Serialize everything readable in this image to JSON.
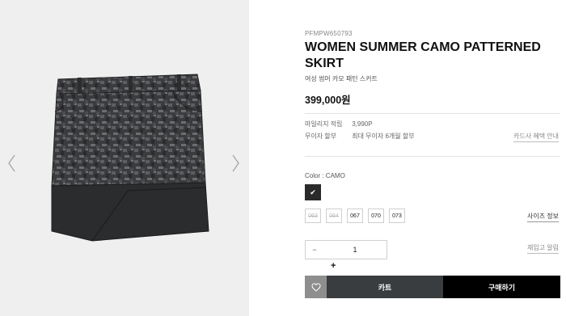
{
  "product": {
    "sku": "PFMPW650793",
    "title": "WOMEN SUMMER CAMO PATTERNED SKIRT",
    "subtitle_kr": "여성 썸머 카모 패턴 스커트",
    "price": "399,000원"
  },
  "benefits": {
    "mileage_label": "마일리지 적립",
    "mileage_value": "3,990P",
    "installment_label": "무이자 할부",
    "installment_value": "최대 무이자 6개월 할부",
    "card_link": "카드사 혜택 안내"
  },
  "options": {
    "color_label": "Color : CAMO",
    "sizes": [
      {
        "label": "063",
        "available": false
      },
      {
        "label": "064",
        "available": false
      },
      {
        "label": "067",
        "available": true
      },
      {
        "label": "070",
        "available": true
      },
      {
        "label": "073",
        "available": true
      }
    ],
    "size_guide": "사이즈 정보",
    "restock": "재입고 알림"
  },
  "quantity": {
    "minus": "−",
    "value": "1",
    "plus": "+"
  },
  "actions": {
    "cart": "카트",
    "buy": "구매하기"
  },
  "colors": {
    "cart_bg": "#3a3d3f",
    "buy_bg": "#000000",
    "wish_bg": "#8e8e8e",
    "gallery_bg": "#efefef"
  },
  "icons": {
    "left": "chevron-left-icon",
    "right": "chevron-right-icon",
    "wish": "heart-icon",
    "check": "check-icon"
  }
}
